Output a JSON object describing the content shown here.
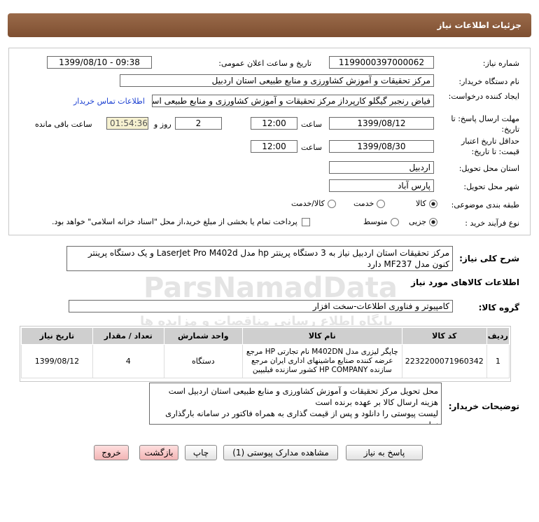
{
  "page_title": "جزئیات اطلاعات نیاز",
  "fields": {
    "need_number_label": "شماره نیاز:",
    "need_number": "1199000397000062",
    "announce_label": "تاریخ و ساعت اعلان عمومی:",
    "announce_value": "1399/08/10 - 09:38",
    "buyer_org_label": "نام دستگاه خریدار:",
    "buyer_org": "مرکز تحقیقات و آموزش کشاورزی و منابع طبیعی استان اردبیل",
    "creator_label": "ایجاد کننده درخواست:",
    "creator": "فیاض رنجبر گیگلو کارپرداز مرکز تحقیقات و آموزش کشاورزی و منابع طبیعی استان",
    "contact_link": "اطلاعات تماس خریدار",
    "reply_deadline_label": "مهلت ارسال پاسخ: تا تاریخ:",
    "reply_date": "1399/08/12",
    "time_label": "ساعت",
    "reply_time": "12:00",
    "days_value": "2",
    "days_label": "روز و",
    "timer": "01:54:36",
    "remaining_label": "ساعت باقی مانده",
    "price_validity_label": "حداقل تاریخ اعتبار قیمت: تا تاریخ:",
    "validity_date": "1399/08/30",
    "validity_time": "12:00",
    "province_label": "استان محل تحویل:",
    "province": "اردبیل",
    "city_label": "شهر محل تحویل:",
    "city": "پارس آباد",
    "category_label": "طبقه بندی موضوعی:",
    "category_options": [
      "کالا",
      "خدمت",
      "کالا/خدمت"
    ],
    "process_label": "نوع فرآیند خرید :",
    "process_options": [
      "جزیی",
      "متوسط"
    ],
    "payment_text": "پرداخت تمام یا بخشی از مبلغ خرید،از محل \"اسناد خزانه اسلامی\" خواهد بود."
  },
  "description": {
    "label": "شرح کلی نیاز:",
    "text": "مرکز تحقیقات استان اردبیل نیاز به 3 دستگاه پرینتر hp مدل LaserJet Pro M402d و یک دستگاه پرینتر کنون مدل MF237 دارد"
  },
  "goods_section_title": "اطلاعات کالاهای مورد نیاز",
  "goods_group_label": "گروه کالا:",
  "goods_group": "کامپیوتر و فناوری اطلاعات-سخت افزار",
  "table": {
    "headers": [
      "ردیف",
      "کد کالا",
      "نام کالا",
      "واحد شمارش",
      "تعداد / مقدار",
      "تاریخ نیاز"
    ],
    "row": {
      "index": "1",
      "code": "2232200071960342",
      "name": "چاپگر لیزری مدل M402DN نام تجارتی HP مرجع عرضه کننده صنایع ماشینهای اداری ایران مرجع سازنده HP COMPANY کشور سازنده فیلیپین",
      "unit": "دستگاه",
      "qty": "4",
      "date": "1399/08/12"
    }
  },
  "buyer_notes": {
    "label": "توضیحات خریدار:",
    "line1": "محل تحویل مرکز تحقیقات و آموزش کشاورزی و منابع طبیعی استان اردبیل است",
    "line2": "هزینه ارسال کالا بر عهده برنده است",
    "line3": "لیست پیوستی را دانلود و پس از قیمت گذاری به همراه فاکتور در سامانه بارگذاری نمایید."
  },
  "buttons": {
    "reply": "پاسخ به نیاز",
    "attachments": "مشاهده مدارک پیوستی (1)",
    "print": "چاپ",
    "back": "بازگشت",
    "exit": "خروج"
  },
  "watermark": {
    "brand": "ParsNamadData",
    "persian": "پایگاه اطلاع رسانی مناقصات و مزایده ها"
  },
  "colors": {
    "header": "#8a5a3c",
    "link": "#1a3fd1",
    "timer_bg": "#f6f1d0",
    "table_header": "#cfcfcf"
  }
}
